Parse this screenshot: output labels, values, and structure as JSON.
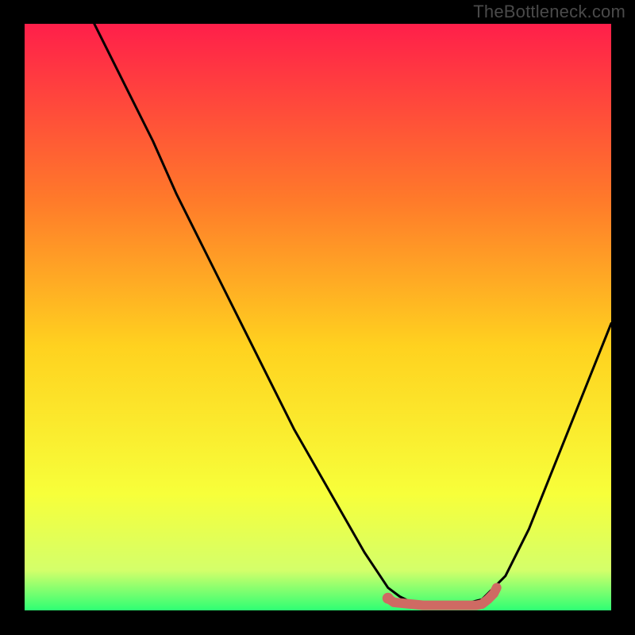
{
  "watermark": "TheBottleneck.com",
  "chart_data": {
    "type": "line",
    "title": "",
    "xlabel": "",
    "ylabel": "",
    "xlim": [
      0,
      100
    ],
    "ylim": [
      0,
      100
    ],
    "grid": false,
    "series": [
      {
        "name": "curve",
        "color": "#000000",
        "x": [
          12,
          14,
          18,
          22,
          26,
          30,
          34,
          38,
          42,
          46,
          50,
          54,
          58,
          60,
          62,
          64,
          66,
          70,
          74,
          78,
          82,
          86,
          90,
          94,
          98,
          100
        ],
        "y": [
          100,
          96,
          88,
          80,
          71,
          63,
          55,
          47,
          39,
          31,
          24,
          17,
          10,
          7,
          4,
          2.5,
          1.5,
          1,
          1,
          2,
          6,
          14,
          24,
          34,
          44,
          49
        ]
      },
      {
        "name": "bottom-highlight",
        "color": "#cf6a63",
        "x": [
          62,
          63,
          68,
          74,
          77,
          78,
          79,
          80,
          80.5
        ],
        "y": [
          2.2,
          1.5,
          1,
          1,
          1,
          1.2,
          2,
          3,
          4
        ]
      }
    ],
    "marker": {
      "name": "dot",
      "color": "#cf6a63",
      "x": 62,
      "y": 2.2
    },
    "background_gradient": {
      "top": "#ff1f4a",
      "upper_mid": "#ff7a2a",
      "mid": "#ffd21f",
      "lower_mid": "#f7ff3a",
      "near_bottom": "#d4ff6a",
      "bottom": "#2bff74"
    }
  }
}
